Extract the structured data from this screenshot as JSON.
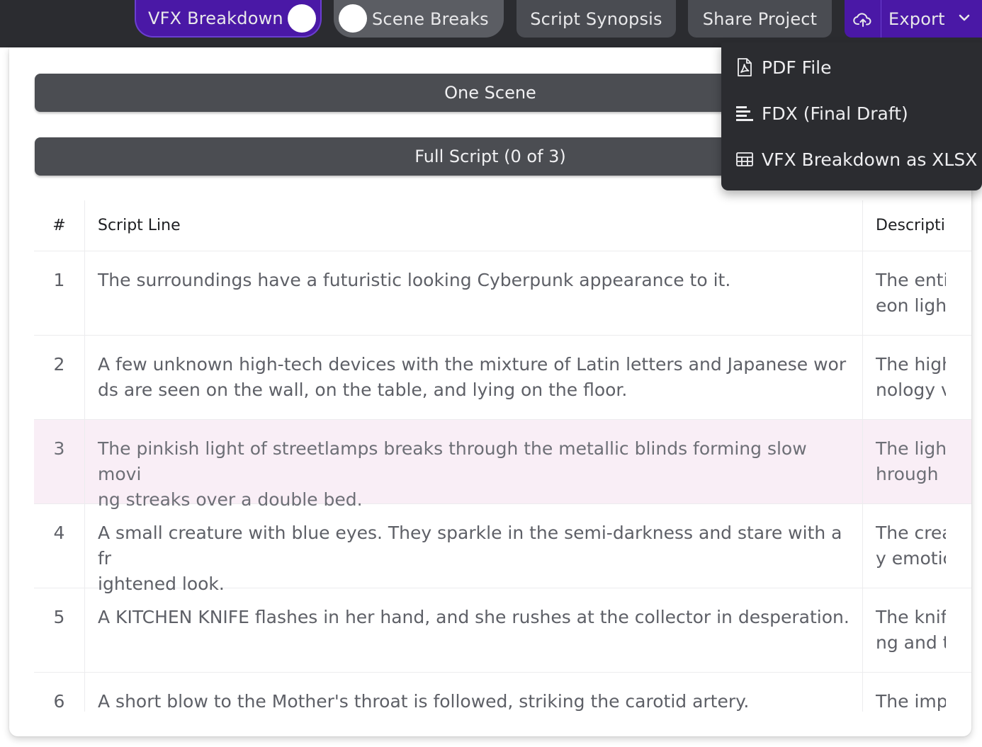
{
  "topbar": {
    "vfx_toggle_label": "VFX Breakdown",
    "scene_toggle_label": "Scene Breaks",
    "synopsis_label": "Script Synopsis",
    "share_label": "Share Project",
    "export_label": "Export"
  },
  "export_menu": {
    "items": [
      {
        "label": "PDF File",
        "icon": "pdf-file-icon"
      },
      {
        "label": "FDX (Final Draft)",
        "icon": "align-left-icon"
      },
      {
        "label": "VFX Breakdown as XLSX",
        "icon": "table-grid-icon"
      }
    ]
  },
  "actions": {
    "one_scene_label": "One Scene",
    "full_script_label": "Full Script (0 of 3)"
  },
  "table": {
    "headers": {
      "num": "#",
      "line": "Script Line",
      "desc": "Descripti"
    },
    "rows": [
      {
        "num": "1",
        "line1": "The surroundings have a futuristic looking Cyberpunk appearance to it.",
        "line2": "",
        "desc1": "The enti",
        "desc2": "eon ligh"
      },
      {
        "num": "2",
        "line1": "A few unknown high-tech devices with the mixture of Latin letters and Japanese wor",
        "line2": "ds are seen on the wall, on the table, and lying on the floor.",
        "desc1": "The high",
        "desc2": "nology v"
      },
      {
        "num": "3",
        "line1": "The pinkish light of streetlamps breaks through the metallic blinds forming slow movi",
        "line2": "ng streaks over a double bed.",
        "desc1": "The light",
        "desc2": "hrough"
      },
      {
        "num": "4",
        "line1": "A small creature with blue eyes. They sparkle in the semi-darkness and stare with a fr",
        "line2": "ightened look.",
        "desc1": "The crea",
        "desc2": "y emotic"
      },
      {
        "num": "5",
        "line1": "A KITCHEN KNIFE flashes in her hand, and she rushes at the collector in desperation.",
        "line2": "",
        "desc1": "The knife",
        "desc2": "ng and t"
      },
      {
        "num": "6",
        "line1": "A short blow to the Mother's throat is followed, striking the carotid artery.",
        "line2": "",
        "desc1": "The imp",
        "desc2": ""
      }
    ]
  },
  "colors": {
    "accent": "#4a18a6",
    "topbar": "#2b2c30",
    "highlight_row": "#f9eef6"
  }
}
